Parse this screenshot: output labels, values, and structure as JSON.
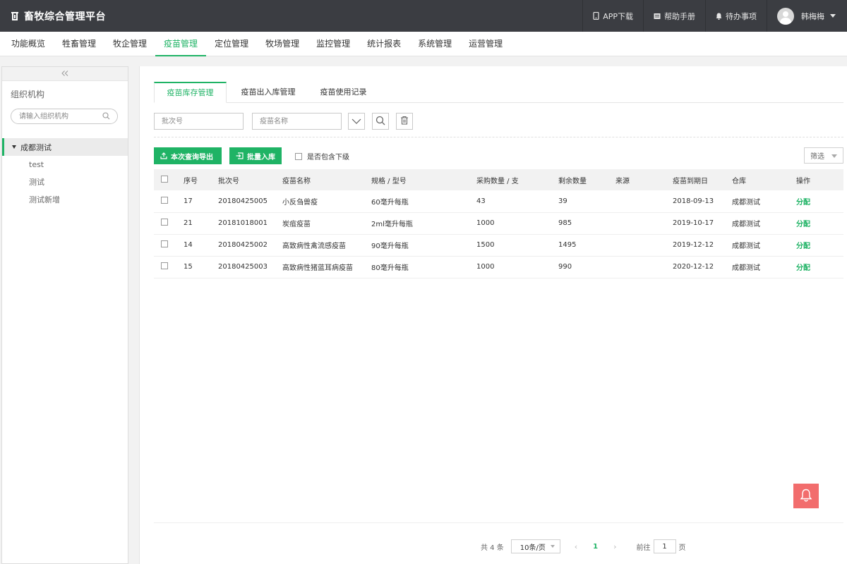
{
  "app": {
    "title": "畜牧综合管理平台"
  },
  "topbar": {
    "app_download": "APP下载",
    "help_manual": "帮助手册",
    "todo": "待办事项",
    "user_name": "韩梅梅"
  },
  "nav": {
    "items": [
      "功能概览",
      "牲畜管理",
      "牧企管理",
      "疫苗管理",
      "定位管理",
      "牧场管理",
      "监控管理",
      "统计报表",
      "系统管理",
      "运营管理"
    ],
    "active": "疫苗管理"
  },
  "sidebar": {
    "title": "组织机构",
    "search_placeholder": "请输入组织机构",
    "tree": {
      "root": "成都测试",
      "children": [
        "test",
        "测试",
        "测试新增"
      ]
    }
  },
  "tabs": [
    "疫苗库存管理",
    "疫苗出入库管理",
    "疫苗使用记录"
  ],
  "filters": {
    "batch_placeholder": "批次号",
    "name_placeholder": "疫苗名称"
  },
  "actions": {
    "export_label": "本次查询导出",
    "batch_in_label": "批量入库",
    "include_sub_label": "是否包含下级",
    "filter_select": "筛选"
  },
  "table": {
    "headers": [
      "序号",
      "批次号",
      "疫苗名称",
      "规格 / 型号",
      "采购数量 / 支",
      "剩余数量",
      "来源",
      "疫苗到期日",
      "仓库",
      "操作"
    ],
    "rows": [
      {
        "no": "17",
        "batch": "20180425005",
        "name": "小反刍兽疫",
        "spec": "60毫升每瓶",
        "purchased": "43",
        "remaining": "39",
        "source": "",
        "expiry": "2018-09-13",
        "warehouse": "成都测试",
        "op": "分配"
      },
      {
        "no": "21",
        "batch": "20181018001",
        "name": "炭疽疫苗",
        "spec": "2ml毫升每瓶",
        "purchased": "1000",
        "remaining": "985",
        "source": "",
        "expiry": "2019-10-17",
        "warehouse": "成都测试",
        "op": "分配"
      },
      {
        "no": "14",
        "batch": "20180425002",
        "name": "高致病性禽流感疫苗",
        "spec": "90毫升每瓶",
        "purchased": "1500",
        "remaining": "1495",
        "source": "",
        "expiry": "2019-12-12",
        "warehouse": "成都测试",
        "op": "分配"
      },
      {
        "no": "15",
        "batch": "20180425003",
        "name": "高致病性猪蓝耳病疫苗",
        "spec": "80毫升每瓶",
        "purchased": "1000",
        "remaining": "990",
        "source": "",
        "expiry": "2020-12-12",
        "warehouse": "成都测试",
        "op": "分配"
      }
    ]
  },
  "pagination": {
    "total_text": "共 4 条",
    "page_size": "10条/页",
    "prev": "‹",
    "current": "1",
    "next": "›",
    "goto_label": "前往",
    "goto_value": "1",
    "page_unit": "页"
  },
  "colors": {
    "accent": "#1fb365",
    "topbar": "#3b3d42",
    "alert": "#f26d6d"
  }
}
